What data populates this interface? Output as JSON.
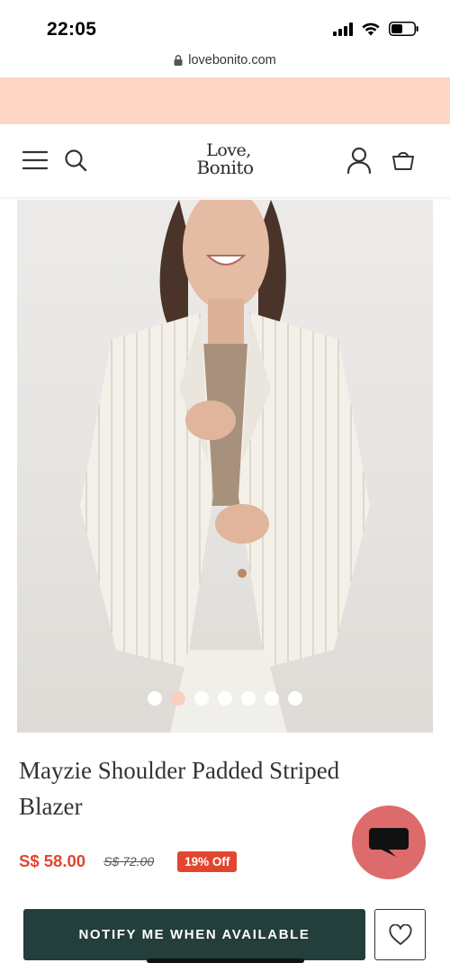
{
  "status_bar": {
    "time": "22:05",
    "icons": [
      "signal-icon",
      "wifi-icon",
      "battery-icon"
    ]
  },
  "browser": {
    "url": "lovebonito.com",
    "icon": "lock-icon"
  },
  "promo_banner": {
    "color": "#fdd6c5"
  },
  "header": {
    "menu_icon": "hamburger-menu-icon",
    "search_icon": "search-icon",
    "logo_line1": "Love,",
    "logo_line2": "Bonito",
    "account_icon": "user-account-icon",
    "cart_icon": "shopping-bag-icon"
  },
  "product": {
    "image_icon": "product-photo",
    "carousel": {
      "total": 7,
      "active_index": 1
    },
    "title": "Mayzie Shoulder Padded Striped Blazer",
    "price": "S$ 58.00",
    "original_price": "S$ 72.00",
    "discount": "19% Off"
  },
  "actions": {
    "notify_label": "NOTIFY ME WHEN AVAILABLE",
    "wishlist_icon": "heart-icon",
    "chat_icon": "chat-bubble-icon"
  },
  "colors": {
    "accent_price": "#e2452f",
    "button_dark": "#233e3b",
    "chat_bubble": "#dd6b6b",
    "dot_active": "#f9cfbf"
  }
}
